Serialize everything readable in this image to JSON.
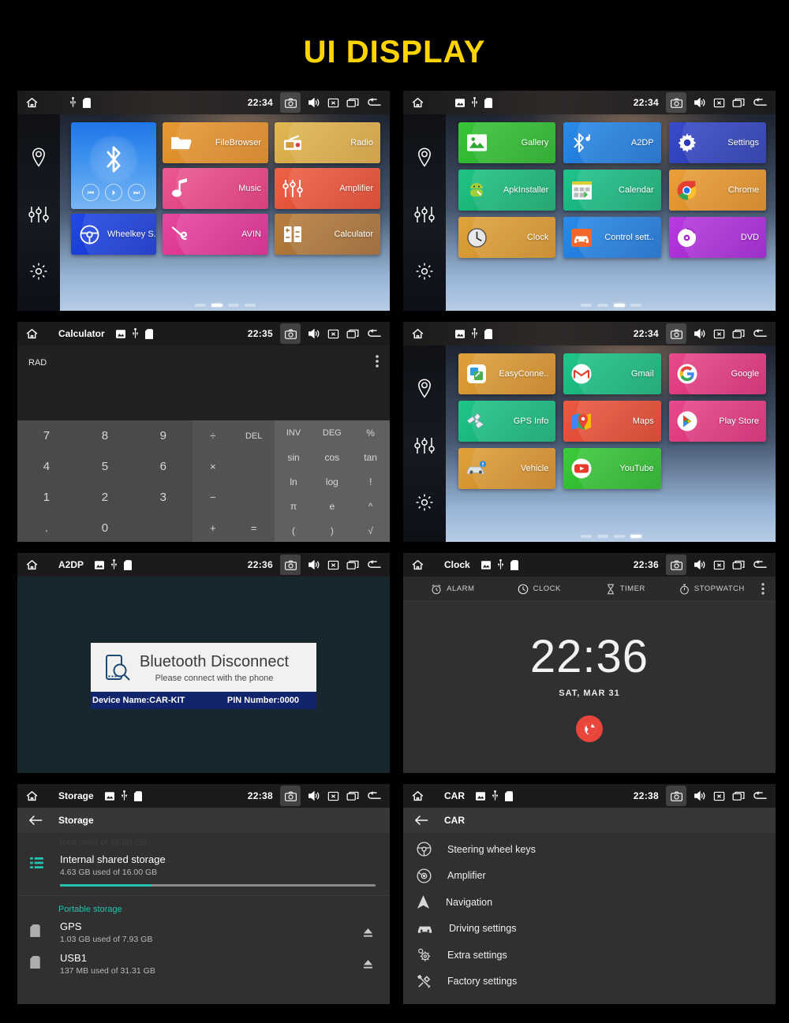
{
  "heading": "UI DISPLAY",
  "theme": {
    "title_color": "#FFD400",
    "accent_teal": "#24C1AE",
    "fab_red": "#E8463A",
    "page_bg": "#000000"
  },
  "panels": [
    {
      "id": "launcher-page-2",
      "type": "launcher",
      "statusbar": {
        "title": "",
        "time": "22:34",
        "icons": [
          "home-icon",
          "usb-icon",
          "sdcard-icon"
        ],
        "right_icons": [
          "camera-icon",
          "volume-icon",
          "close-icon",
          "recents-icon",
          "back-icon"
        ]
      },
      "sidebar": [
        "location-pin-icon",
        "equalizer-icon",
        "gear-icon"
      ],
      "widget": {
        "name": "Bluetooth",
        "icon": "bluetooth-icon",
        "controls": [
          "prev-track-icon",
          "play-pause-icon",
          "next-track-icon"
        ]
      },
      "tiles": [
        {
          "label": "FileBrowser",
          "icon": "folder-icon",
          "color": "#e08f2a",
          "color2": "#c8761c"
        },
        {
          "label": "Radio",
          "icon": "radio-icon",
          "color": "#ddb14a",
          "color2": "#c9973a"
        },
        {
          "label": "Music",
          "icon": "music-note-icon",
          "color": "#e8457e",
          "color2": "#d02f6b"
        },
        {
          "label": "Amplifier",
          "icon": "amplifier-icon",
          "color": "#ea5238",
          "color2": "#d13c26"
        },
        {
          "label": "Wheelkey S..",
          "icon": "steering-wheel-icon",
          "color": "#1a3fe0",
          "color2": "#1030c8"
        },
        {
          "label": "AVIN",
          "icon": "avin-icon",
          "color": "#e2369a",
          "color2": "#cc2287"
        },
        {
          "label": "Calculator",
          "icon": "calculator-icon",
          "color": "#b07840",
          "color2": "#96602e"
        }
      ],
      "page_dots": {
        "count": 4,
        "active": 2
      }
    },
    {
      "id": "launcher-page-3",
      "type": "launcher",
      "statusbar": {
        "title": "",
        "time": "22:34",
        "icons": [
          "image-icon",
          "usb-icon",
          "sdcard-icon"
        ],
        "right_icons": [
          "camera-icon",
          "volume-icon",
          "close-icon",
          "recents-icon",
          "back-icon"
        ]
      },
      "sidebar": [
        "location-pin-icon",
        "equalizer-icon",
        "gear-icon"
      ],
      "tiles": [
        {
          "label": "Gallery",
          "icon": "gallery-icon",
          "color": "#2fbd2f",
          "color2": "#21a521"
        },
        {
          "label": "A2DP",
          "icon": "bluetooth-audio-icon",
          "color": "#1f7fe0",
          "color2": "#1566c4"
        },
        {
          "label": "Settings",
          "icon": "gear-icon",
          "color": "#2f41bb",
          "color2": "#2232a2"
        },
        {
          "label": "ApkInstaller",
          "icon": "apk-installer-icon",
          "color": "#14b877",
          "color2": "#0f9c63"
        },
        {
          "label": "Calendar",
          "icon": "calendar-icon",
          "color": "#18b980",
          "color2": "#11a06c"
        },
        {
          "label": "Chrome",
          "icon": "chrome-icon",
          "color": "#e39328",
          "color2": "#cc7c18"
        },
        {
          "label": "Clock",
          "icon": "clock-icon",
          "color": "#d99b33",
          "color2": "#c58320"
        },
        {
          "label": "Control sett..",
          "icon": "car-control-icon",
          "color": "#1f7fe0",
          "color2": "#1566c4"
        },
        {
          "label": "DVD",
          "icon": "dvd-icon",
          "color": "#a92ed6",
          "color2": "#921ac0"
        }
      ],
      "page_dots": {
        "count": 4,
        "active": 3
      }
    },
    {
      "id": "calculator",
      "type": "calculator",
      "statusbar": {
        "title": "Calculator",
        "time": "22:35",
        "icons": [
          "image-icon",
          "usb-icon",
          "sdcard-icon"
        ],
        "right_icons": [
          "camera-icon",
          "volume-icon",
          "close-icon",
          "recents-icon",
          "back-icon"
        ]
      },
      "mode": "RAD",
      "display": "",
      "overflow_icon": "kebab-menu-icon",
      "numpad": [
        "7",
        "8",
        "9",
        "4",
        "5",
        "6",
        "1",
        "2",
        "3",
        ".",
        "0"
      ],
      "oppad": [
        "÷",
        "DEL",
        "×",
        "",
        "−",
        "",
        "+",
        "="
      ],
      "fnpad": [
        "INV",
        "DEG",
        "%",
        "sin",
        "cos",
        "tan",
        "ln",
        "log",
        "!",
        "π",
        "e",
        "^",
        "(",
        ")",
        "√"
      ]
    },
    {
      "id": "launcher-page-4",
      "type": "launcher",
      "statusbar": {
        "title": "",
        "time": "22:34",
        "icons": [
          "image-icon",
          "usb-icon",
          "sdcard-icon"
        ],
        "right_icons": [
          "camera-icon",
          "volume-icon",
          "close-icon",
          "recents-icon",
          "back-icon"
        ]
      },
      "sidebar": [
        "location-pin-icon",
        "equalizer-icon",
        "gear-icon"
      ],
      "tiles": [
        {
          "label": "EasyConne..",
          "icon": "easyconnect-icon",
          "color": "#d9952f",
          "color2": "#c27c1c"
        },
        {
          "label": "Gmail",
          "icon": "gmail-icon",
          "color": "#14b87f",
          "color2": "#0fa06b"
        },
        {
          "label": "Google",
          "icon": "google-g-icon",
          "color": "#e1357e",
          "color2": "#c9206a"
        },
        {
          "label": "GPS Info",
          "icon": "satellite-icon",
          "color": "#14b87f",
          "color2": "#0fa06b"
        },
        {
          "label": "Maps",
          "icon": "maps-icon",
          "color": "#e54b34",
          "color2": "#cc3720"
        },
        {
          "label": "Play Store",
          "icon": "play-store-icon",
          "color": "#e1357e",
          "color2": "#c9206a"
        },
        {
          "label": "Vehicle",
          "icon": "vehicle-icon",
          "color": "#d9952f",
          "color2": "#c27c1c"
        },
        {
          "label": "YouTube",
          "icon": "youtube-icon",
          "color": "#2fbd2f",
          "color2": "#21a521"
        }
      ],
      "page_dots": {
        "count": 4,
        "active": 4
      }
    },
    {
      "id": "a2dp",
      "type": "bluetooth",
      "statusbar": {
        "title": "A2DP",
        "time": "22:36",
        "icons": [
          "image-icon",
          "usb-icon",
          "sdcard-icon"
        ],
        "right_icons": [
          "camera-icon",
          "volume-icon",
          "close-icon",
          "recents-icon",
          "back-icon"
        ]
      },
      "card": {
        "icon": "phone-search-icon",
        "headline": "Bluetooth Disconnect",
        "subline": "Please connect with the phone",
        "device_name": "Device Name:CAR-KIT",
        "pin": "PIN Number:0000"
      }
    },
    {
      "id": "clock",
      "type": "clock",
      "statusbar": {
        "title": "Clock",
        "time": "22:36",
        "icons": [
          "image-icon",
          "usb-icon",
          "sdcard-icon"
        ],
        "right_icons": [
          "camera-icon",
          "volume-icon",
          "close-icon",
          "recents-icon",
          "back-icon"
        ]
      },
      "tabs": [
        {
          "label": "ALARM",
          "icon": "alarm-icon"
        },
        {
          "label": "CLOCK",
          "icon": "clock-face-icon"
        },
        {
          "label": "TIMER",
          "icon": "hourglass-icon"
        },
        {
          "label": "STOPWATCH",
          "icon": "stopwatch-icon"
        }
      ],
      "overflow_icon": "kebab-menu-icon",
      "time_display": "22:36",
      "date_display": "SAT, MAR 31",
      "fab_icon": "globe-icon"
    },
    {
      "id": "storage",
      "type": "storage",
      "statusbar": {
        "title": "Storage",
        "time": "22:38",
        "icons": [
          "image-icon",
          "usb-icon",
          "sdcard-icon"
        ],
        "right_icons": [
          "camera-icon",
          "volume-icon",
          "close-icon",
          "recents-icon",
          "back-icon"
        ]
      },
      "back_icon": "arrow-back-icon",
      "screen_title": "Storage",
      "ghost_line": "Total used of 16.00 GB",
      "internal": {
        "icon": "list-icon",
        "title": "Internal shared storage",
        "subtitle": "4.63 GB used of 16.00 GB",
        "percent": 29
      },
      "portable_header": "Portable storage",
      "portable": [
        {
          "icon": "sdcard-icon",
          "title": "GPS",
          "subtitle": "1.03 GB used of 7.93 GB",
          "eject_icon": "eject-icon"
        },
        {
          "icon": "sdcard-icon",
          "title": "USB1",
          "subtitle": "137 MB used of 31.31 GB",
          "eject_icon": "eject-icon"
        }
      ]
    },
    {
      "id": "car",
      "type": "carlist",
      "statusbar": {
        "title": "CAR",
        "time": "22:38",
        "icons": [
          "image-icon",
          "usb-icon",
          "sdcard-icon"
        ],
        "right_icons": [
          "camera-icon",
          "volume-icon",
          "close-icon",
          "recents-icon",
          "back-icon"
        ]
      },
      "back_icon": "arrow-back-icon",
      "screen_title": "CAR",
      "items": [
        {
          "label": "Steering wheel keys",
          "icon": "steering-wheel-icon"
        },
        {
          "label": "Amplifier",
          "icon": "speaker-icon"
        },
        {
          "label": "Navigation",
          "icon": "navigation-arrow-icon"
        },
        {
          "label": "Driving settings",
          "icon": "car-icon"
        },
        {
          "label": "Extra settings",
          "icon": "gears-icon"
        },
        {
          "label": "Factory settings",
          "icon": "tools-icon"
        }
      ]
    }
  ]
}
